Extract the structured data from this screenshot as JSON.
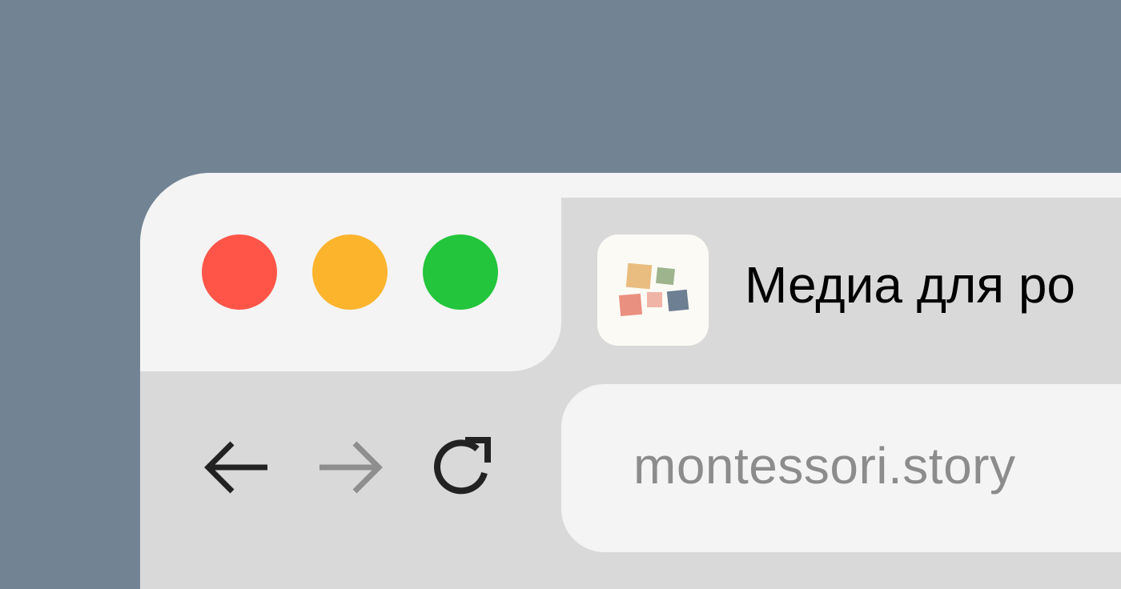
{
  "colors": {
    "background": "#728494",
    "chrome_light": "#f4f4f4",
    "chrome_dark": "#d9d9d9",
    "close": "#ff5549",
    "minimize": "#fdb42d",
    "zoom": "#22c53b",
    "nav_active": "#222222",
    "nav_disabled": "#8e8e8e",
    "url_text": "#8c8c8c"
  },
  "window": {
    "traffic_lights": [
      "close",
      "minimize",
      "zoom"
    ]
  },
  "tab": {
    "favicon": "montessori-logo-icon",
    "title": "Медиа для ро"
  },
  "toolbar": {
    "back_icon": "arrow-left-icon",
    "forward_icon": "arrow-right-icon",
    "forward_disabled": true,
    "reload_icon": "reload-icon"
  },
  "address_bar": {
    "url": "montessori.story"
  }
}
